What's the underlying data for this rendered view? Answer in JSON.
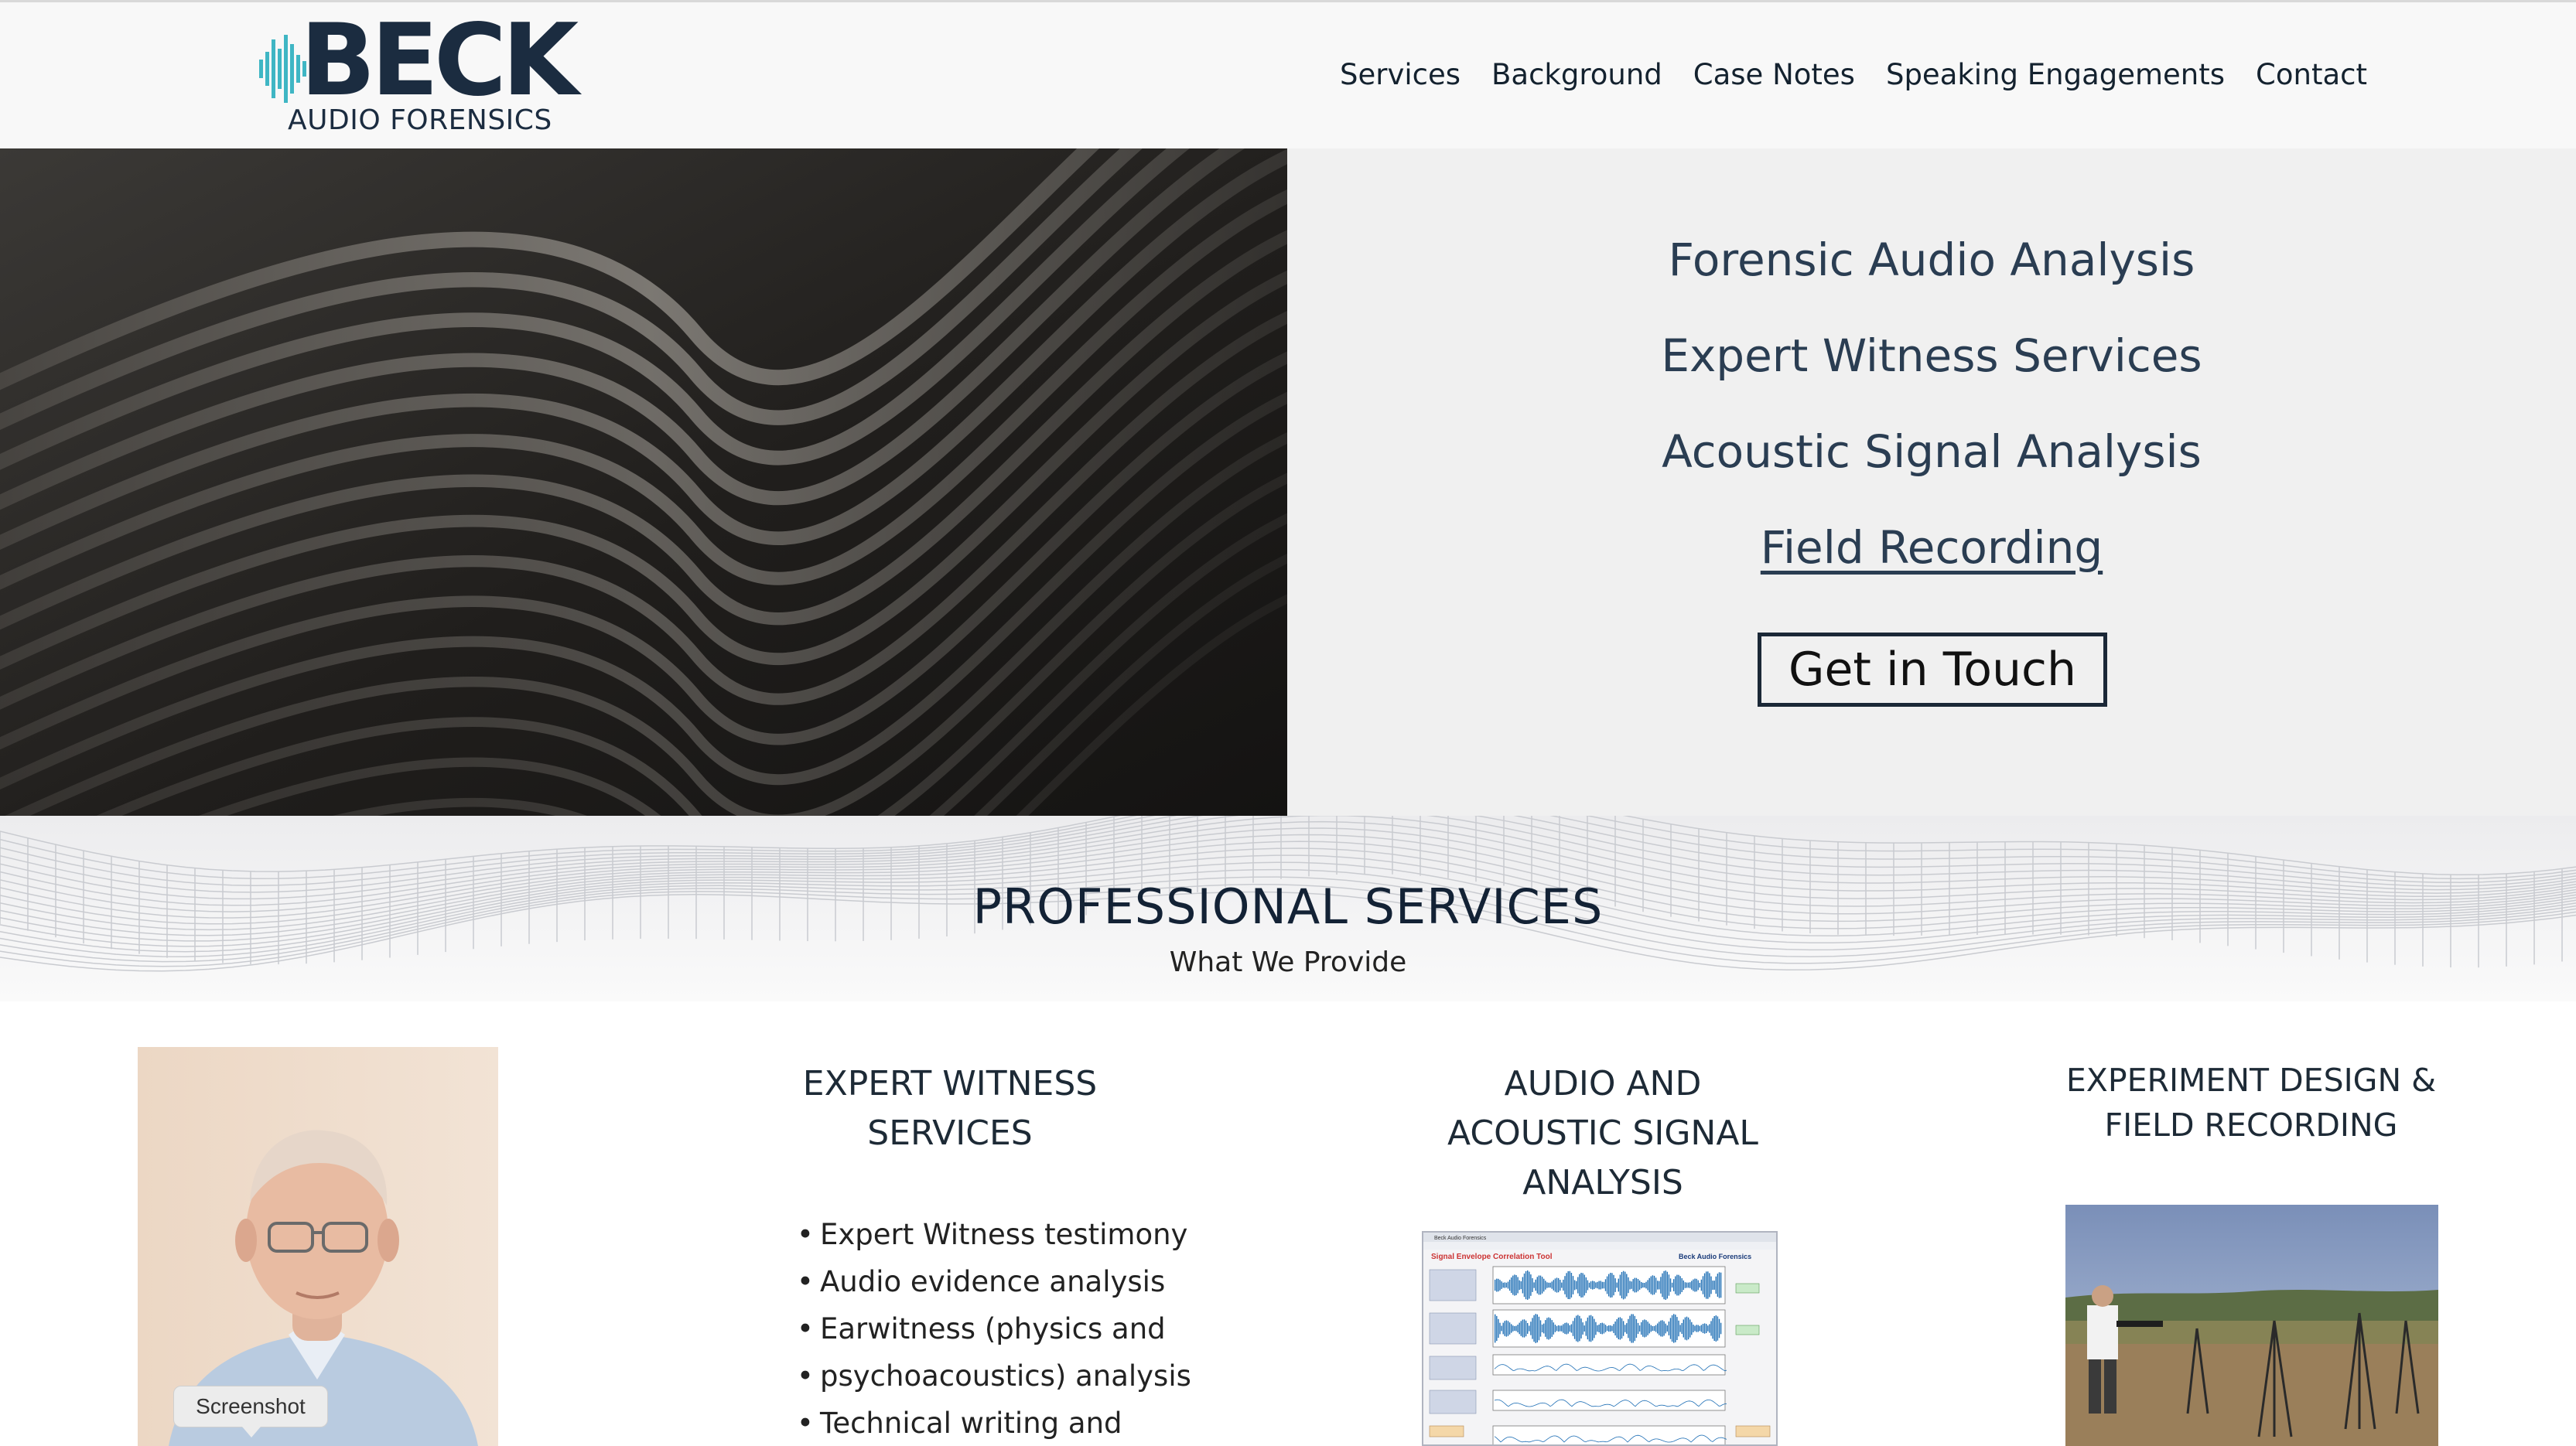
{
  "header": {
    "logo": {
      "wordmark": "BECK",
      "subtitle": "AUDIO FORENSICS"
    },
    "nav": [
      {
        "label": "Services"
      },
      {
        "label": "Background"
      },
      {
        "label": "Case Notes"
      },
      {
        "label": "Speaking Engagements"
      },
      {
        "label": "Contact"
      }
    ]
  },
  "hero": {
    "lines": [
      "Forensic Audio Analysis",
      "Expert Witness Services",
      "Acoustic Signal Analysis",
      "Field Recording"
    ],
    "cta_label": "Get in Touch"
  },
  "services": {
    "title": "PROFESSIONAL SERVICES",
    "subtitle": "What We Provide",
    "portrait_tooltip": "Screenshot",
    "columns": [
      {
        "title_lines": [
          "EXPERT WITNESS",
          "SERVICES"
        ],
        "items": [
          "Expert Witness testimony",
          "Audio evidence analysis",
          "Earwitness (physics and",
          "psychoacoustics) analysis",
          "Technical writing and"
        ]
      },
      {
        "title_lines": [
          "AUDIO AND",
          "ACOUSTIC SIGNAL",
          "ANALYSIS"
        ],
        "tool": {
          "window_title": "Beck Audio Forensics",
          "tool_title": "Signal Envelope Correlation Tool",
          "brand": "Beck Audio Forensics"
        }
      },
      {
        "title_lines": [
          "EXPERIMENT DESIGN &",
          "FIELD RECORDING"
        ]
      }
    ]
  },
  "colors": {
    "brand_navy": "#1b2c40",
    "hero_panel_bg": "#f0f0f0",
    "header_bg": "#f8f8f8"
  }
}
